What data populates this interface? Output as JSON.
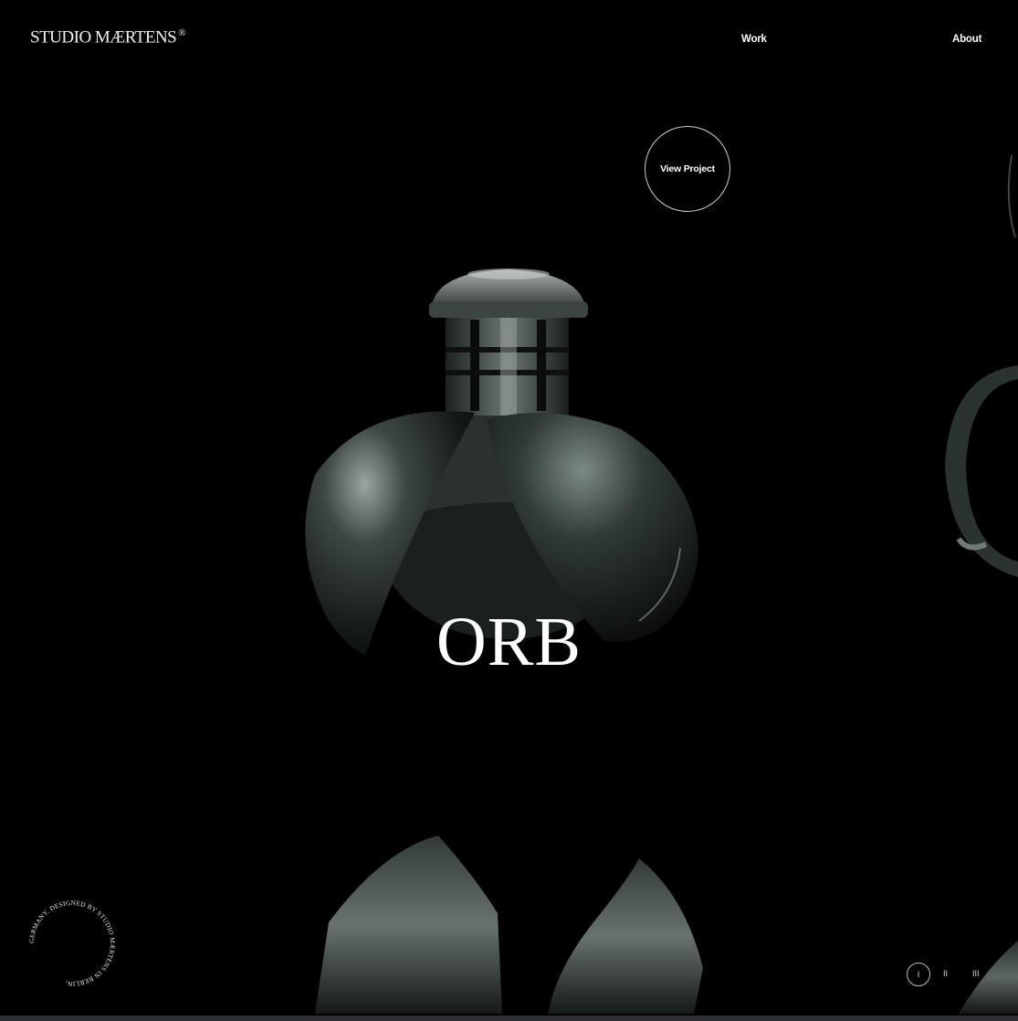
{
  "header": {
    "logo": "STUDIO MÆRTENS",
    "logo_mark": "®",
    "nav": {
      "work": "Work",
      "about": "About"
    }
  },
  "hero": {
    "cta": "View Project",
    "title": "ORB"
  },
  "badge": {
    "text": "GERMANY. DESIGNED BY STUDIO MÆRTENS IN BERLIN, "
  },
  "pagination": {
    "items": [
      "I",
      "II",
      "III"
    ],
    "active_index": 0
  },
  "colors": {
    "background": "#000000",
    "foreground": "#ffffff",
    "bottom_bar": "#2e3033"
  }
}
